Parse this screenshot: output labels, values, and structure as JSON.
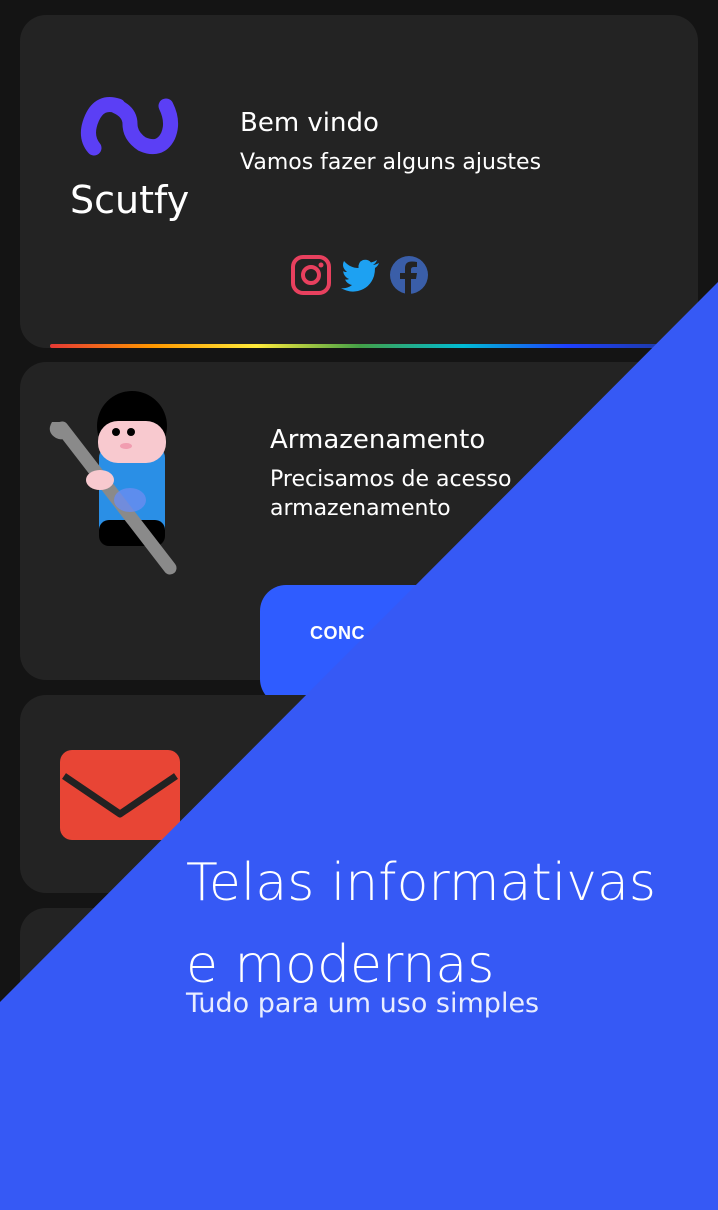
{
  "welcome": {
    "app_name": "Scutfy",
    "title": "Bem vindo",
    "subtitle": "Vamos fazer alguns ajustes",
    "socials": [
      "instagram-icon",
      "twitter-icon",
      "facebook-icon"
    ]
  },
  "storage": {
    "title": "Armazenamento",
    "line1": "Precisamos de acesso",
    "line2": "armazenamento",
    "button_label": "CONC"
  },
  "promo": {
    "line1": "Telas informativas",
    "line2": "e modernas",
    "subtitle": "Tudo para um uso simples"
  },
  "colors": {
    "background": "#141414",
    "card": "#232323",
    "accent_blue": "#3659f5",
    "button_blue": "#2f5cff",
    "logo_purple": "#5b3ff5",
    "mail_red": "#e84535"
  }
}
